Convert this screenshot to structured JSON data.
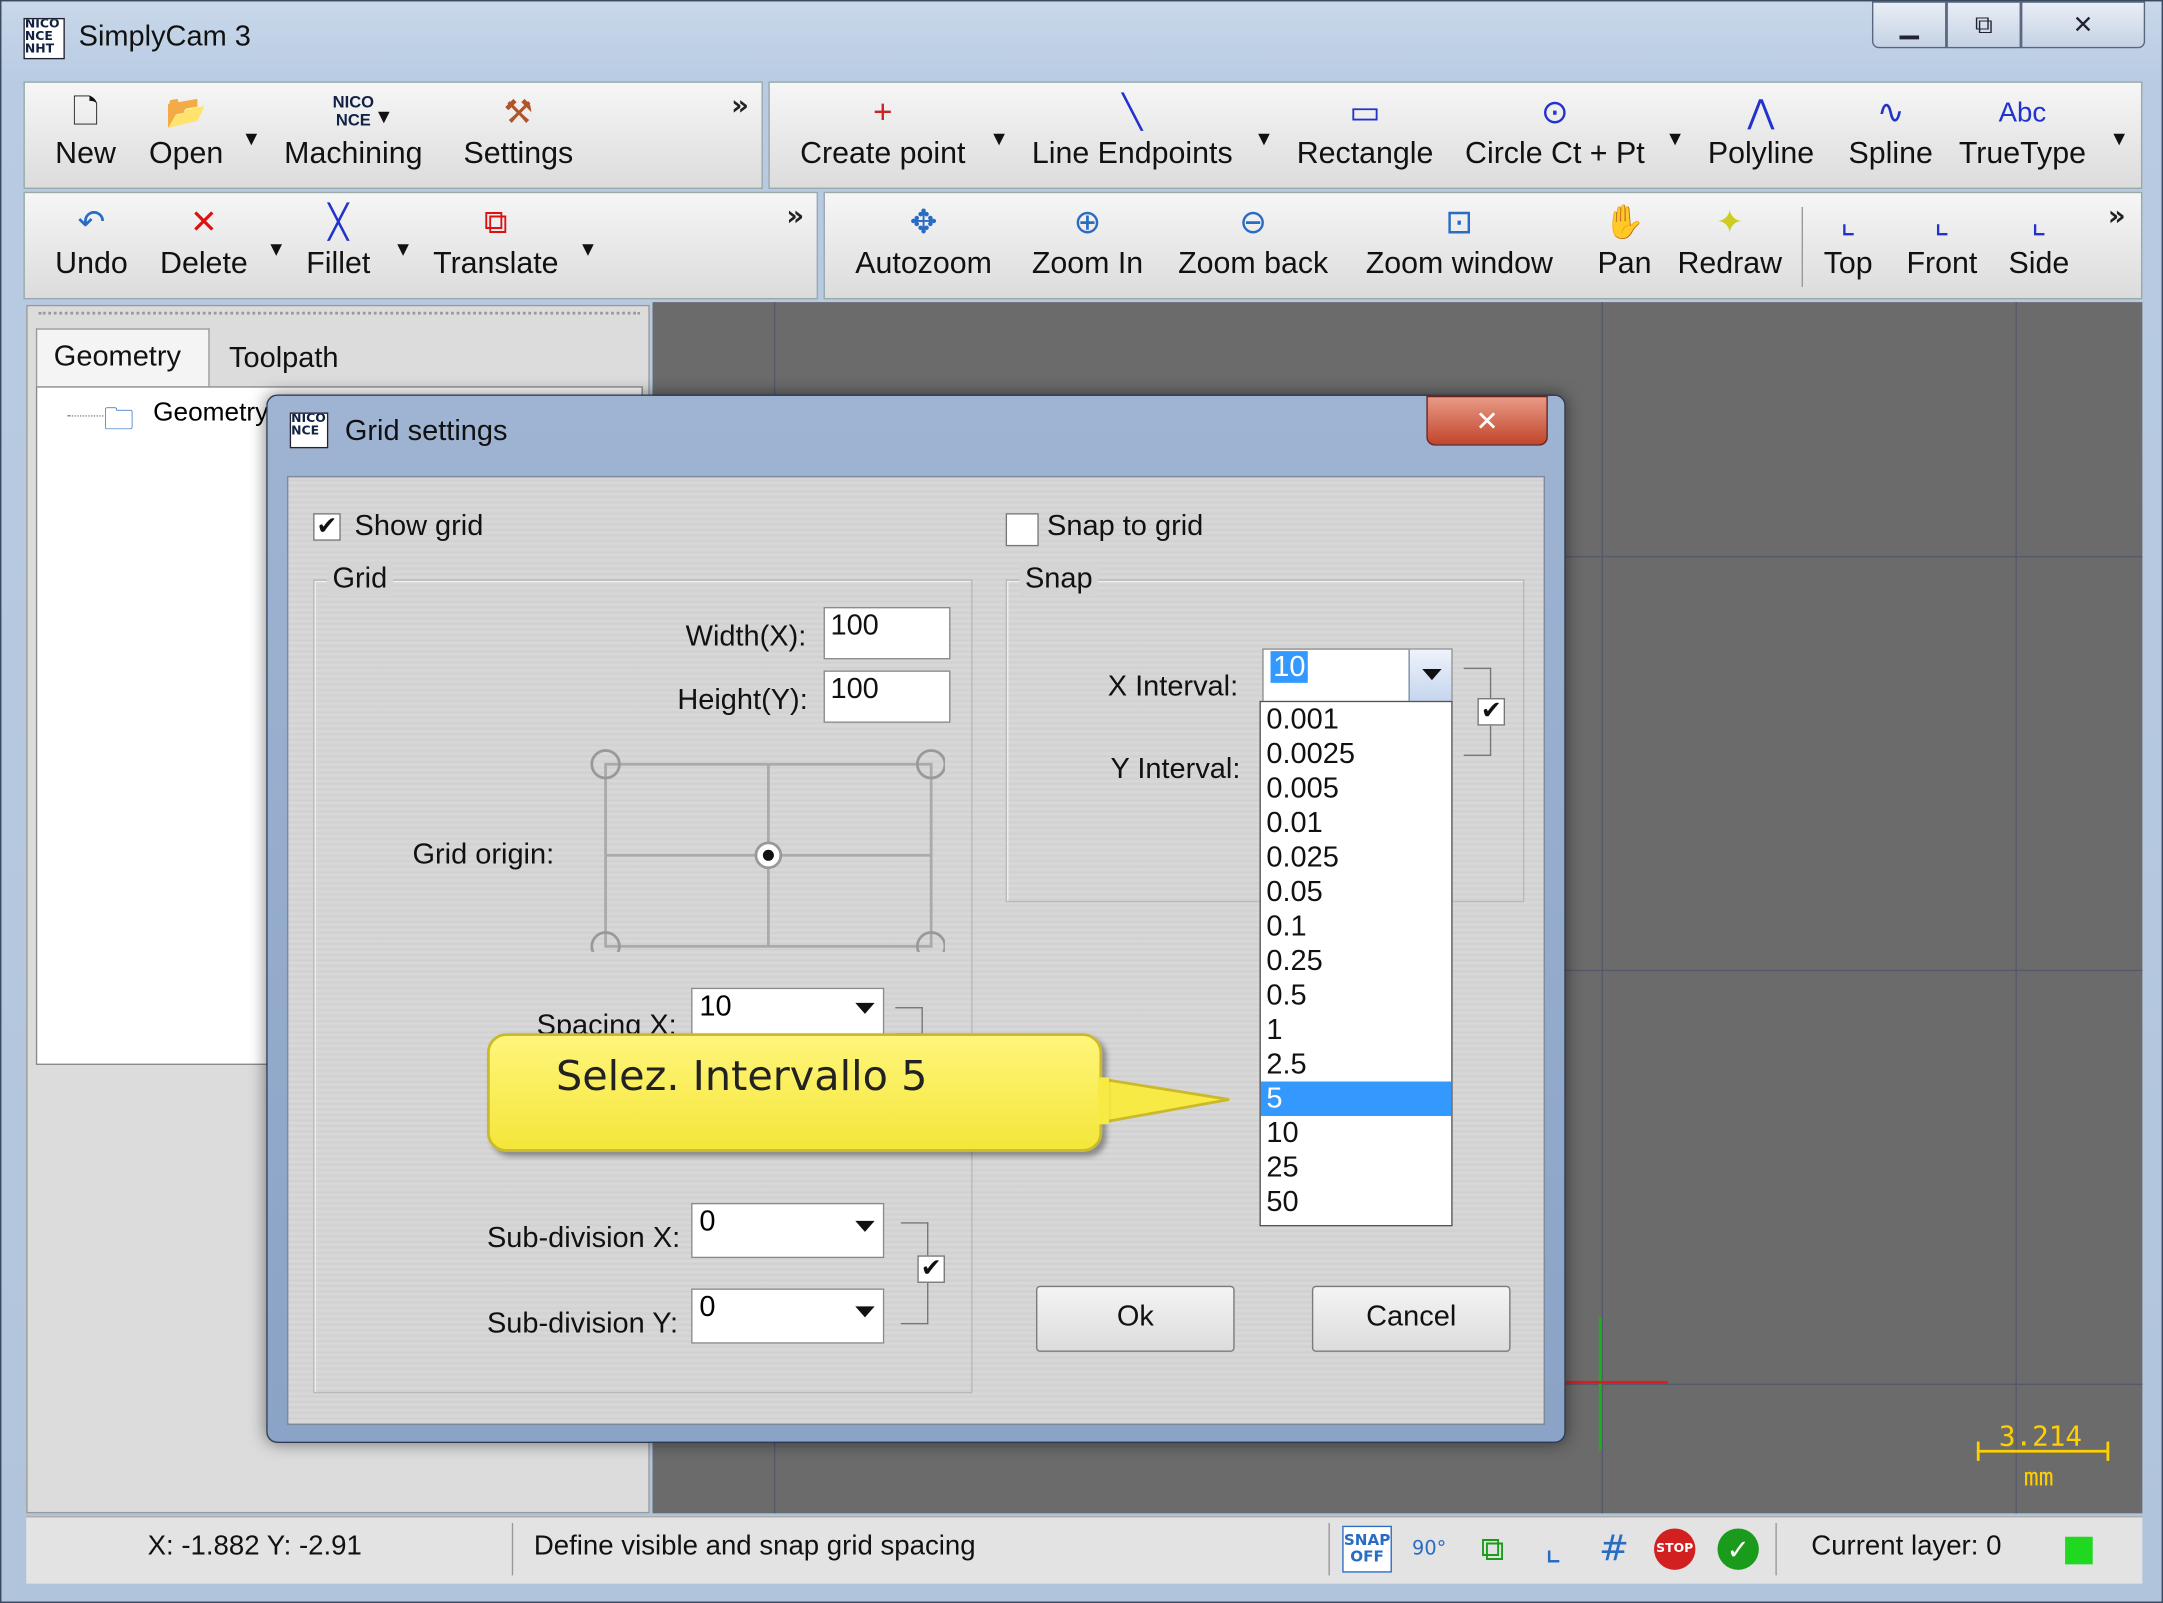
{
  "window": {
    "title": "SimplyCam 3",
    "icon": "app-logo-icon",
    "minimize": "▭",
    "maximize": "⧉",
    "close": "✕"
  },
  "toolbar_file": {
    "new": "New",
    "open": "Open",
    "machining": "Machining",
    "settings": "Settings"
  },
  "toolbar_draw": {
    "create_point": "Create point",
    "line_endpoints": "Line Endpoints",
    "rectangle": "Rectangle",
    "circle": "Circle Ct + Pt",
    "polyline": "Polyline",
    "spline": "Spline",
    "truetype": "TrueType"
  },
  "toolbar_edit": {
    "undo": "Undo",
    "delete": "Delete",
    "fillet": "Fillet",
    "translate": "Translate"
  },
  "toolbar_view": {
    "autozoom": "Autozoom",
    "zoom_in": "Zoom In",
    "zoom_back": "Zoom back",
    "zoom_window": "Zoom window",
    "pan": "Pan",
    "redraw": "Redraw",
    "top": "Top",
    "front": "Front",
    "side": "Side"
  },
  "panel": {
    "tab_geometry": "Geometry",
    "tab_toolpath": "Toolpath",
    "tree_root": "Geometry"
  },
  "dialog": {
    "title": "Grid settings",
    "show_grid": "Show grid",
    "snap_to_grid": "Snap to grid",
    "grid_group": "Grid",
    "snap_group": "Snap",
    "width_label": "Width(X):",
    "width_value": "100",
    "height_label": "Height(Y):",
    "height_value": "100",
    "grid_origin_label": "Grid origin:",
    "spacing_x_label": "Spacing X:",
    "spacing_x_value": "10",
    "subdiv_x_label": "Sub-division X:",
    "subdiv_x_value": "0",
    "subdiv_y_label": "Sub-division Y:",
    "subdiv_y_value": "0",
    "x_interval_label": "X Interval:",
    "x_interval_value": "10",
    "y_interval_label": "Y Interval:",
    "ok": "Ok",
    "cancel": "Cancel",
    "interval_options": [
      "0.001",
      "0.0025",
      "0.005",
      "0.01",
      "0.025",
      "0.05",
      "0.1",
      "0.25",
      "0.5",
      "1",
      "2.5",
      "5",
      "10",
      "25",
      "50"
    ],
    "selected_option_index": 11
  },
  "callout": {
    "text": "Selez. Intervallo 5"
  },
  "canvas": {
    "scale_value": "3.214",
    "scale_unit": "mm"
  },
  "status": {
    "coords": "X: -1.882 Y: -2.91",
    "message": "Define visible and snap grid spacing",
    "layer": "Current layer: 0",
    "snap_badge": "SNAP\nOFF",
    "angle_badge": "90°",
    "stop_badge": "STOP"
  }
}
